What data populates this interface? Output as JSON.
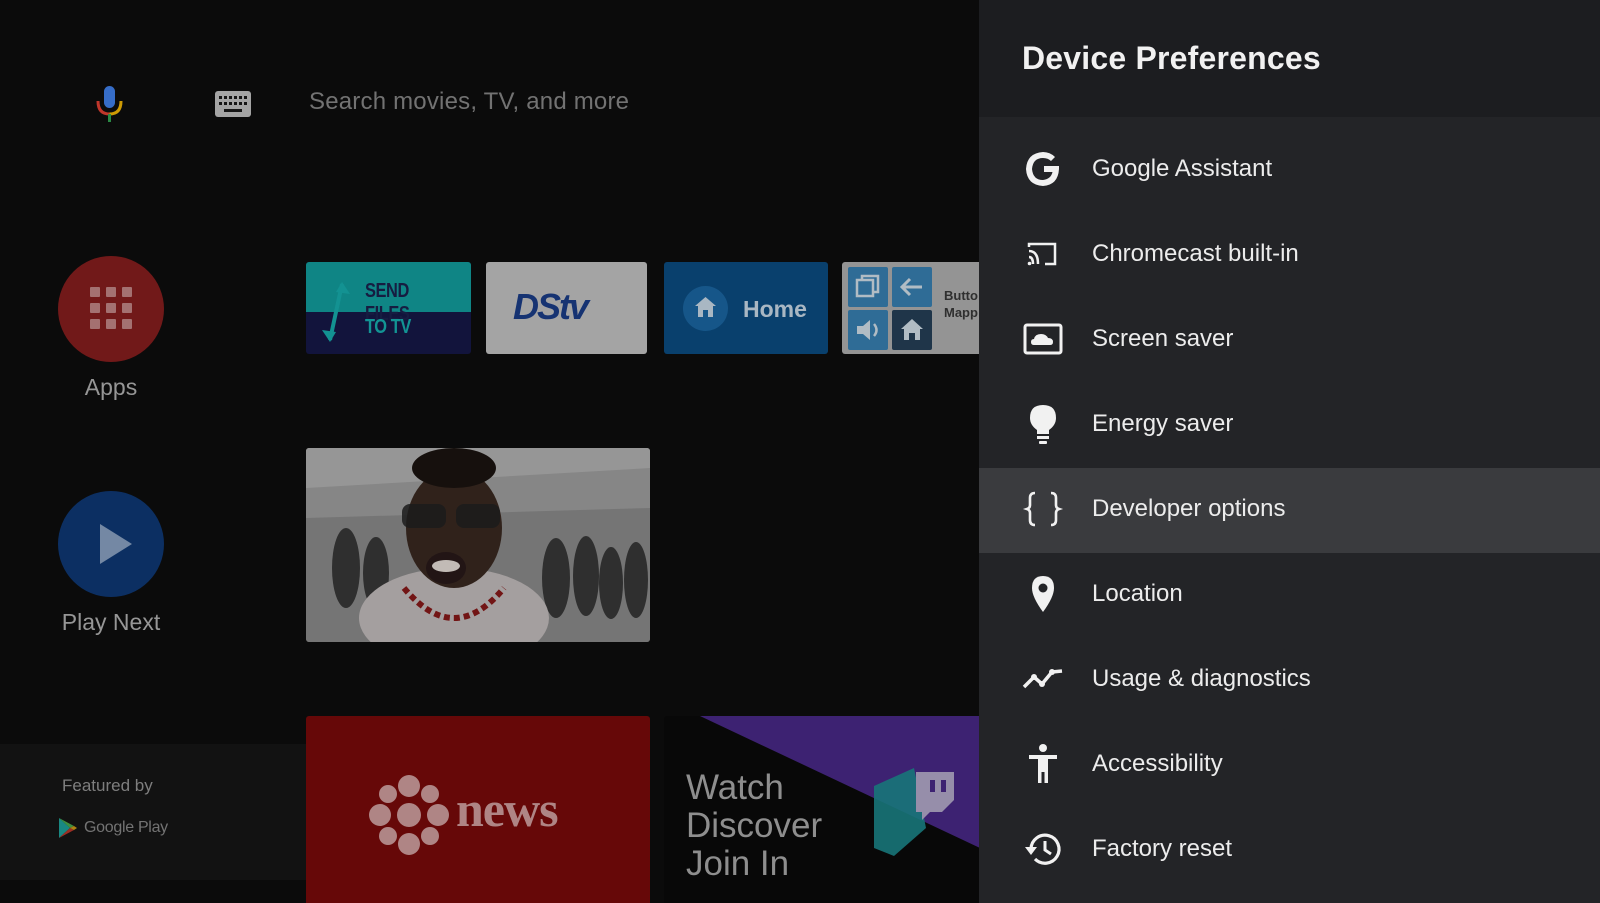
{
  "search": {
    "placeholder": "Search movies, TV, and more"
  },
  "sidebar": {
    "apps_label": "Apps",
    "play_next_label": "Play Next"
  },
  "featured": {
    "title": "Featured by",
    "store": "Google Play"
  },
  "tiles": {
    "send_files": {
      "line1": "SEND FILES",
      "line2": "TO TV"
    },
    "dstv": {
      "logo": "DStv"
    },
    "home": {
      "label": "Home"
    },
    "button_mapper": {
      "line1": "Butto",
      "line2": "Mapp"
    },
    "cbc": {
      "label": "news"
    },
    "twitch": {
      "line1": "Watch",
      "line2": "Discover",
      "line3": "Join In"
    }
  },
  "panel": {
    "title": "Device Preferences",
    "selected_index": 4,
    "items": [
      {
        "label": "Google Assistant",
        "icon": "google-g-icon"
      },
      {
        "label": "Chromecast built-in",
        "icon": "cast-icon"
      },
      {
        "label": "Screen saver",
        "icon": "screensaver-icon"
      },
      {
        "label": "Energy saver",
        "icon": "lightbulb-icon"
      },
      {
        "label": "Developer options",
        "icon": "braces-icon"
      },
      {
        "label": "Location",
        "icon": "location-pin-icon"
      },
      {
        "label": "Usage & diagnostics",
        "icon": "trend-icon"
      },
      {
        "label": "Accessibility",
        "icon": "accessibility-icon"
      },
      {
        "label": "Factory reset",
        "icon": "history-icon"
      }
    ]
  },
  "colors": {
    "panel_bg": "#232427",
    "selected_bg": "#3a3b3e",
    "apps_red": "#8a1f1f",
    "play_blue": "#0f3a78"
  }
}
